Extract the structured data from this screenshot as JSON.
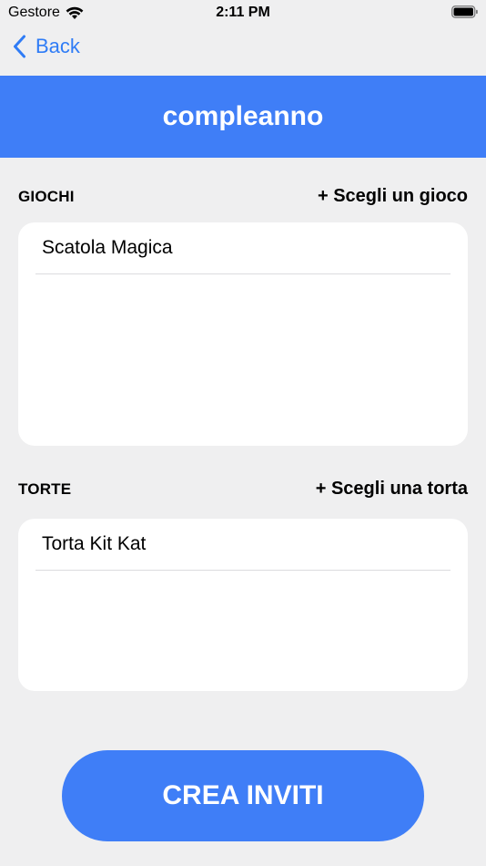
{
  "status_bar": {
    "carrier": "Gestore",
    "time": "2:11 PM"
  },
  "nav": {
    "back_label": "Back"
  },
  "header": {
    "title": "compleanno",
    "accent_color": "#3f7ef7"
  },
  "games_section": {
    "label": "GIOCHI",
    "action_label": "+ Scegli un gioco",
    "items": [
      "Scatola Magica"
    ]
  },
  "cakes_section": {
    "label": "TORTE",
    "action_label": "+ Scegli una torta",
    "items": [
      "Torta Kit Kat"
    ]
  },
  "footer": {
    "create_button_label": "CREA INVITI"
  }
}
